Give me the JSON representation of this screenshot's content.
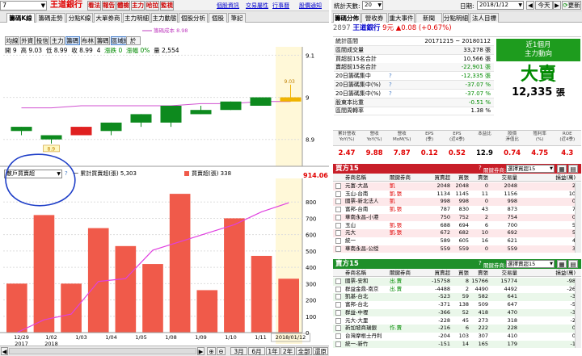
{
  "top": {
    "code_partial": "7",
    "name": "王道銀行",
    "menu": [
      "看法",
      "報告",
      "體檢",
      "主力",
      "哈拉",
      "監視"
    ],
    "links": [
      "個股資訊",
      "交易屬性",
      "行事曆",
      "股價通知"
    ],
    "range_label": "統計天數:",
    "range_value": "20",
    "date_label": "日期:",
    "date_value": "2018/1/12",
    "today": "今天",
    "refresh": "更新"
  },
  "left_tabs": [
    "籌碼K線",
    "籌碼走勢",
    "分點K線",
    "大單券商",
    "主力明細",
    "主力動態",
    "個股分析",
    "個股",
    "筆記"
  ],
  "sub_buttons": [
    "均線",
    "外資",
    "投信",
    "主力",
    "籌碼",
    "布林",
    "籌碼",
    "區域線",
    "於"
  ],
  "kinfo": {
    "open": "開 9",
    "high": "高 9.03",
    "low": "低 8.99",
    "close": "收 8.99",
    "volume": "4",
    "chg_pct": "漲跌 0",
    "chg_pct2": "漲幅 0%",
    "vol2": "量 2,554",
    "cost_label": "籌碼成本 8.98"
  },
  "price_axis": [
    "9.1",
    "9",
    "8.9"
  ],
  "price_marks": {
    "high": "9.03",
    "low": "8.9"
  },
  "lower": {
    "select_value": "散戶買賣超",
    "legend1": "一 累計買賣超(張) 5,303",
    "legend2": "買賣超(張) 338",
    "topval": "914.06",
    "axis": [
      "800",
      "700",
      "600",
      "500",
      "400",
      "300",
      "200",
      "100",
      "0"
    ]
  },
  "dates": [
    "12/29\n2017",
    "1/02\n2018",
    "1/03",
    "1/04",
    "1/05",
    "1/08",
    "1/09",
    "1/10",
    "1/11",
    "2018/01/12"
  ],
  "bottom_buttons": [
    "3月",
    "6月",
    "1年",
    "2年",
    "全部",
    "還原"
  ],
  "chart_data": [
    {
      "type": "candlestick",
      "categories": [
        "12/29",
        "1/02",
        "1/03",
        "1/04",
        "1/05",
        "1/08",
        "1/09",
        "1/10",
        "1/11",
        "1/12"
      ],
      "candles": [
        [
          8.93,
          8.93,
          8.91,
          8.92
        ],
        [
          8.91,
          8.91,
          8.89,
          8.9
        ],
        [
          8.91,
          8.93,
          8.91,
          8.93
        ],
        [
          8.94,
          8.94,
          8.91,
          8.92
        ],
        [
          8.96,
          8.96,
          8.93,
          8.94
        ],
        [
          8.98,
          8.98,
          8.93,
          8.94
        ],
        [
          8.97,
          8.98,
          8.96,
          8.96
        ],
        [
          8.99,
          8.99,
          8.97,
          8.97
        ],
        [
          9.0,
          9.0,
          8.98,
          8.98
        ],
        [
          9.0,
          9.03,
          8.99,
          8.99
        ]
      ],
      "line": [
        8.975,
        8.975,
        8.98,
        8.98,
        8.98,
        8.98,
        8.985,
        8.985,
        8.99,
        8.99
      ],
      "ylim": [
        8.84,
        9.12
      ]
    },
    {
      "type": "bar",
      "categories": [
        "12/29",
        "1/02",
        "1/03",
        "1/04",
        "1/05",
        "1/08",
        "1/09",
        "1/10",
        "1/11",
        "1/12"
      ],
      "values": [
        300,
        720,
        300,
        640,
        530,
        420,
        850,
        260,
        700,
        470,
        330
      ],
      "line": [
        0,
        90,
        130,
        360,
        380,
        580,
        640,
        700,
        760,
        850,
        914
      ],
      "ylim": [
        0,
        900
      ]
    }
  ],
  "right": {
    "code": "2897",
    "name": "王道銀行",
    "price": "9元",
    "change": "▲0.08 (+0.67%)",
    "tabs": [
      "籌碼分佈",
      "營收券",
      "重大事件",
      "新聞",
      "分點明細",
      "法人目標"
    ],
    "stats": [
      [
        "統計區間",
        "20171215 ~ 20180112"
      ],
      [
        "區間成交量",
        "33,278 張"
      ],
      [
        "買超前15名合計",
        "10,566 張"
      ],
      [
        "賣超前15名合計",
        "-22,901 張"
      ],
      [
        "20日籌碼集中",
        "-12,335 張"
      ],
      [
        "20日籌碼集中(%)",
        "-37.07 %"
      ],
      [
        "20日籌碼集中(%)",
        "-37.07 %"
      ],
      [
        "股東本比重",
        "-0.51 %"
      ],
      [
        "區間周轉率",
        "1.38 %"
      ]
    ],
    "badge_title": "近1個月\n主力動向",
    "badge_big": "大賣",
    "badge_num": "12,335",
    "badge_unit": "張",
    "fin_headers": [
      "累計營收\nYoY(%)",
      "營收\nYoY(%)",
      "營收\nMoM(%)",
      "EPS\n(季)",
      "EPS\n(近4季)",
      "本益比",
      "股價\n淨值比",
      "殖利率\n(%)",
      "ROE\n(近4季)"
    ],
    "fin_values": [
      "2.47",
      "9.88",
      "7.87",
      "0.12",
      "0.52",
      "12.9",
      "0.74",
      "4.75",
      "4.3"
    ],
    "buy": {
      "title": "買方15",
      "related": "關鍵券商:",
      "select": "選擇買超15",
      "cols": [
        "券商名稱",
        "關鍵券商",
        "買賣超",
        "買張",
        "賣張",
        "交易量",
        "損益(萬)"
      ],
      "rows": [
        [
          "元富-大昌",
          "凱",
          "2048",
          "2048",
          "0",
          "2048",
          "2"
        ],
        [
          "玉山-台南",
          "凱.張",
          "1134",
          "1145",
          "11",
          "1156",
          "10"
        ],
        [
          "國票-新北法人",
          "凱",
          "998",
          "998",
          "0",
          "998",
          "0"
        ],
        [
          "富邦-台南",
          "凱.張",
          "787",
          "830",
          "43",
          "873",
          "7"
        ],
        [
          "華南永昌-小港",
          "",
          "750",
          "752",
          "2",
          "754",
          "0"
        ],
        [
          "玉山",
          "凱.張",
          "688",
          "694",
          "6",
          "700",
          "5"
        ],
        [
          "元大",
          "凱.張",
          "672",
          "682",
          "10",
          "692",
          "5"
        ],
        [
          "統一",
          "",
          "589",
          "605",
          "16",
          "621",
          "4"
        ],
        [
          "華南永昌-公綬",
          "",
          "559",
          "559",
          "0",
          "559",
          "3"
        ]
      ]
    },
    "sell": {
      "title": "賣方15",
      "related": "關鍵券商:",
      "select": "選擇賣超15",
      "cols": [
        "券商名稱",
        "關鍵券商",
        "買賣超",
        "買張",
        "賣張",
        "交易量",
        "損益(萬)"
      ],
      "rows": [
        [
          "國票-安和",
          "出.賣",
          "-15758",
          "8",
          "15766",
          "15774",
          "-98"
        ],
        [
          "群益金鼎-南京",
          "出.賣",
          "-4488",
          "2",
          "4490",
          "4492",
          "-26"
        ],
        [
          "凱基-台北",
          "",
          "-523",
          "59",
          "582",
          "641",
          "-3"
        ],
        [
          "富邦-台北",
          "",
          "-371",
          "138",
          "509",
          "647",
          "-5"
        ],
        [
          "群益-中壢",
          "",
          "-366",
          "52",
          "418",
          "470",
          "-3"
        ],
        [
          "元大-大里",
          "",
          "-228",
          "45",
          "273",
          "318",
          "-2"
        ],
        [
          "新加坡商瑞銀",
          "作.賣",
          "-216",
          "6",
          "222",
          "228",
          "0"
        ],
        [
          "台灣摩根士丹利",
          "",
          "-204",
          "103",
          "307",
          "410",
          "0"
        ],
        [
          "統一-新竹",
          "",
          "-151",
          "14",
          "165",
          "179",
          "-1"
        ]
      ]
    }
  }
}
